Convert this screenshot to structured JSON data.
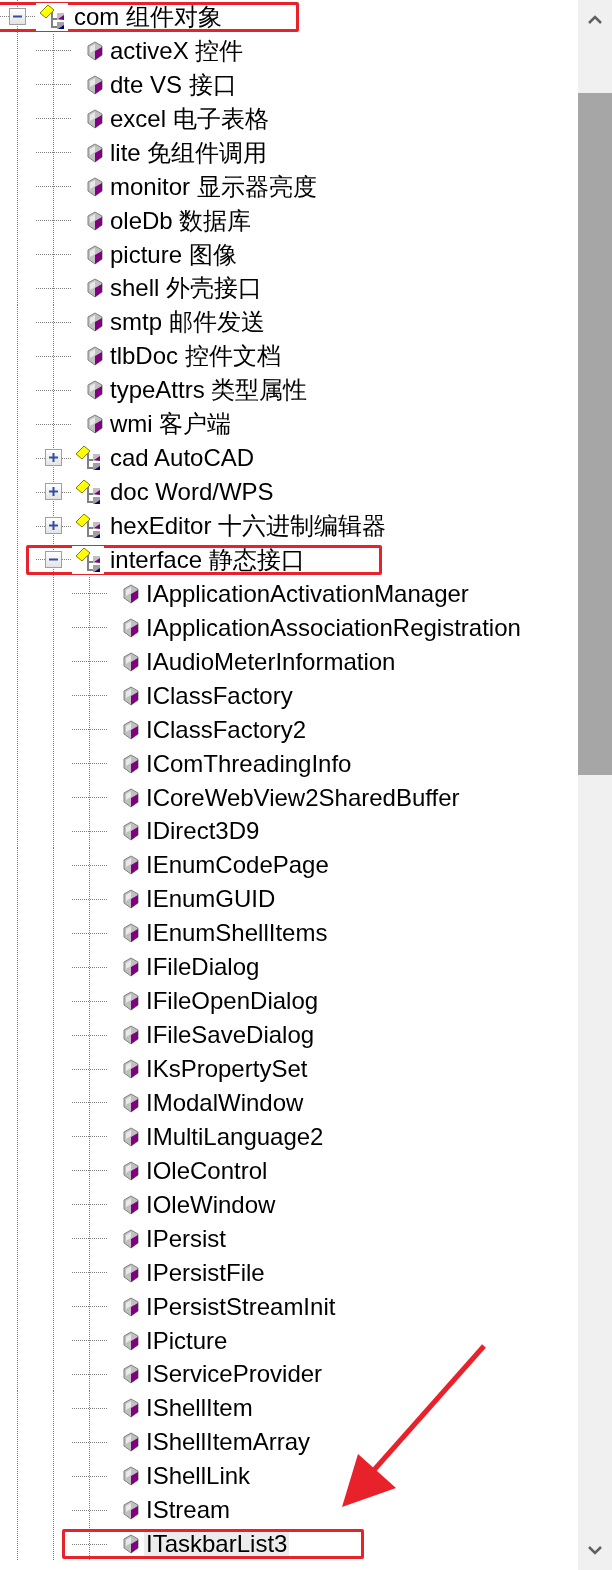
{
  "tree": [
    {
      "label": "com 组件对象",
      "kind": "folder",
      "expanded": true,
      "selected": false,
      "highlighted": true,
      "children": [
        {
          "label": "activeX 控件",
          "kind": "leaf",
          "selected": false
        },
        {
          "label": "dte VS 接口",
          "kind": "leaf",
          "selected": false
        },
        {
          "label": "excel 电子表格",
          "kind": "leaf",
          "selected": false
        },
        {
          "label": "lite 免组件调用",
          "kind": "leaf",
          "selected": false
        },
        {
          "label": "monitor 显示器亮度",
          "kind": "leaf",
          "selected": false
        },
        {
          "label": "oleDb 数据库",
          "kind": "leaf",
          "selected": false
        },
        {
          "label": "picture 图像",
          "kind": "leaf",
          "selected": false
        },
        {
          "label": "shell 外壳接口",
          "kind": "leaf",
          "selected": false
        },
        {
          "label": "smtp 邮件发送",
          "kind": "leaf",
          "selected": false
        },
        {
          "label": "tlbDoc 控件文档",
          "kind": "leaf",
          "selected": false
        },
        {
          "label": "typeAttrs 类型属性",
          "kind": "leaf",
          "selected": false
        },
        {
          "label": "wmi 客户端",
          "kind": "leaf",
          "selected": false
        },
        {
          "label": "cad AutoCAD",
          "kind": "folder",
          "expanded": false,
          "selected": false
        },
        {
          "label": "doc Word/WPS",
          "kind": "folder",
          "expanded": false,
          "selected": false
        },
        {
          "label": "hexEditor 十六进制编辑器",
          "kind": "folder",
          "expanded": false,
          "selected": false
        },
        {
          "label": "interface 静态接口",
          "kind": "folder",
          "expanded": true,
          "selected": false,
          "highlighted": true,
          "children": [
            {
              "label": "IApplicationActivationManager",
              "kind": "leaf",
              "selected": false
            },
            {
              "label": "IApplicationAssociationRegistration",
              "kind": "leaf",
              "selected": false
            },
            {
              "label": "IAudioMeterInformation",
              "kind": "leaf",
              "selected": false
            },
            {
              "label": "IClassFactory",
              "kind": "leaf",
              "selected": false
            },
            {
              "label": "IClassFactory2",
              "kind": "leaf",
              "selected": false
            },
            {
              "label": "IComThreadingInfo",
              "kind": "leaf",
              "selected": false
            },
            {
              "label": "ICoreWebView2SharedBuffer",
              "kind": "leaf",
              "selected": false
            },
            {
              "label": "IDirect3D9",
              "kind": "leaf",
              "selected": false
            },
            {
              "label": "IEnumCodePage",
              "kind": "leaf",
              "selected": false
            },
            {
              "label": "IEnumGUID",
              "kind": "leaf",
              "selected": false
            },
            {
              "label": "IEnumShellItems",
              "kind": "leaf",
              "selected": false
            },
            {
              "label": "IFileDialog",
              "kind": "leaf",
              "selected": false
            },
            {
              "label": "IFileOpenDialog",
              "kind": "leaf",
              "selected": false
            },
            {
              "label": "IFileSaveDialog",
              "kind": "leaf",
              "selected": false
            },
            {
              "label": "IKsPropertySet",
              "kind": "leaf",
              "selected": false
            },
            {
              "label": "IModalWindow",
              "kind": "leaf",
              "selected": false
            },
            {
              "label": "IMultiLanguage2",
              "kind": "leaf",
              "selected": false
            },
            {
              "label": "IOleControl",
              "kind": "leaf",
              "selected": false
            },
            {
              "label": "IOleWindow",
              "kind": "leaf",
              "selected": false
            },
            {
              "label": "IPersist",
              "kind": "leaf",
              "selected": false
            },
            {
              "label": "IPersistFile",
              "kind": "leaf",
              "selected": false
            },
            {
              "label": "IPersistStreamInit",
              "kind": "leaf",
              "selected": false
            },
            {
              "label": "IPicture",
              "kind": "leaf",
              "selected": false
            },
            {
              "label": "IServiceProvider",
              "kind": "leaf",
              "selected": false
            },
            {
              "label": "IShellItem",
              "kind": "leaf",
              "selected": false
            },
            {
              "label": "IShellItemArray",
              "kind": "leaf",
              "selected": false
            },
            {
              "label": "IShellLink",
              "kind": "leaf",
              "selected": false
            },
            {
              "label": "IStream",
              "kind": "leaf",
              "selected": false
            },
            {
              "label": "ITaskbarList3",
              "kind": "leaf",
              "selected": true,
              "highlighted": true,
              "pointed_at": true
            }
          ]
        }
      ]
    }
  ]
}
